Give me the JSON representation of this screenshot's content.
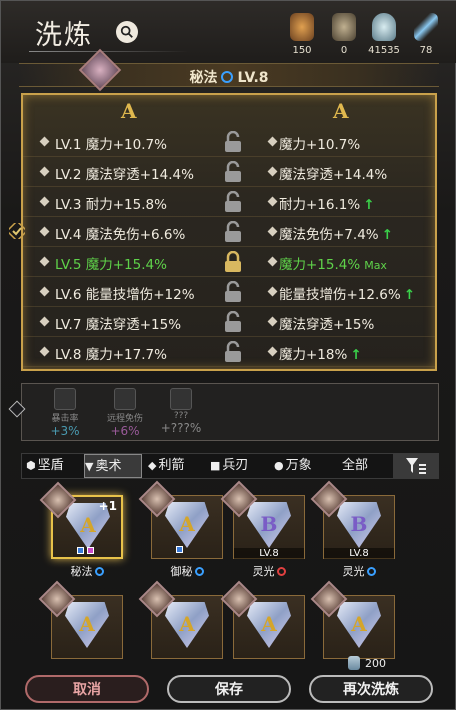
{
  "header": {
    "title": "洗炼"
  },
  "resources": [
    {
      "icon": "ore-icon",
      "value": "150",
      "color": "#b0783a"
    },
    {
      "icon": "stone-icon",
      "value": "0",
      "color": "#8a7a60"
    },
    {
      "icon": "potion-icon",
      "value": "41535",
      "color": "#a8c0c8"
    },
    {
      "icon": "feather-icon",
      "value": "78",
      "color": "#6aa8d8"
    }
  ],
  "skill": {
    "name": "秘法",
    "level": "LV.8"
  },
  "columns": {
    "left_grade": "A",
    "right_grade": "A"
  },
  "attributes": [
    {
      "level": "LV.1",
      "current": "魔力+10.7%",
      "new": "魔力+10.7%",
      "up": false
    },
    {
      "level": "LV.2",
      "current": "魔法穿透+14.4%",
      "new": "魔法穿透+14.4%",
      "up": false
    },
    {
      "level": "LV.3",
      "current": "耐力+15.8%",
      "new": "耐力+16.1%",
      "up": true
    },
    {
      "level": "LV.4",
      "current": "魔法免伤+6.6%",
      "new": "魔法免伤+7.4%",
      "up": true
    },
    {
      "level": "LV.5",
      "current": "魔力+15.4%",
      "new": "魔力+15.4%",
      "up": false,
      "locked": true,
      "max": "Max"
    },
    {
      "level": "LV.6",
      "current": "能量技增伤+12%",
      "new": "能量技增伤+12.6%",
      "up": true
    },
    {
      "level": "LV.7",
      "current": "魔法穿透+15%",
      "new": "魔法穿透+15%",
      "up": false
    },
    {
      "level": "LV.8",
      "current": "魔力+17.7%",
      "new": "魔力+18%",
      "up": true
    }
  ],
  "bonuses": [
    {
      "label": "暴击率",
      "value": "+3%",
      "color": "#4a9ab0"
    },
    {
      "label": "远程免伤",
      "value": "+6%",
      "color": "#9a5a9a"
    },
    {
      "label": "???",
      "value": "+???%",
      "color": "#888888"
    }
  ],
  "tabs": [
    {
      "sym": "⬢",
      "label": "坚盾"
    },
    {
      "sym": "▼",
      "label": "奥术",
      "active": true
    },
    {
      "sym": "◆",
      "label": "利箭"
    },
    {
      "sym": "■",
      "label": "兵刃"
    },
    {
      "sym": "●",
      "label": "万象"
    },
    {
      "sym": "",
      "label": "全部"
    }
  ],
  "cards": [
    {
      "grade": "A",
      "plus": "+1",
      "name": "秘法",
      "swirl": "blue",
      "chips": [
        "#3a7ad8",
        "#c84ac8"
      ],
      "selected": true
    },
    {
      "grade": "A",
      "name": "御秘",
      "swirl": "blue",
      "chips": [
        "#3a7ad8"
      ]
    },
    {
      "grade": "B",
      "level": "LV.8",
      "name": "灵光",
      "swirl": "red"
    },
    {
      "grade": "B",
      "level": "LV.8",
      "name": "灵光",
      "swirl": "blue"
    },
    {
      "grade": "A"
    },
    {
      "grade": "A"
    },
    {
      "grade": "A"
    },
    {
      "grade": "A"
    }
  ],
  "cost": {
    "value": "200"
  },
  "buttons": {
    "cancel": "取消",
    "save": "保存",
    "again": "再次洗炼"
  }
}
